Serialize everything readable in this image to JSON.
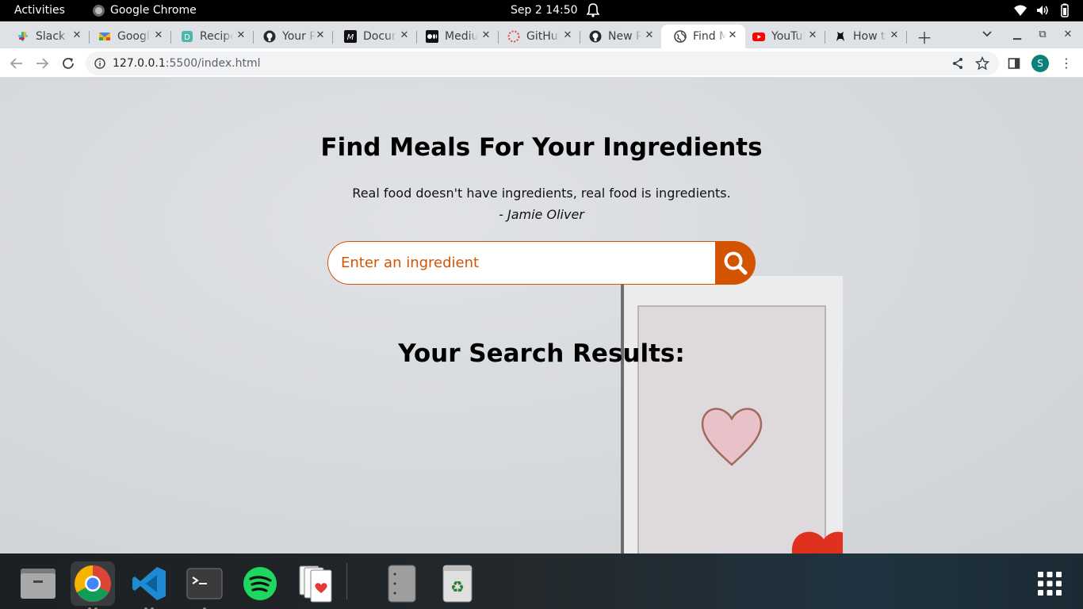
{
  "system": {
    "activities": "Activities",
    "app_name": "Google Chrome",
    "clock": "Sep 2  14:50"
  },
  "tabs": [
    {
      "title": "Slack",
      "icon": "slack-icon"
    },
    {
      "title": "Google",
      "icon": "google-workspace-icon"
    },
    {
      "title": "Recipe",
      "icon": "d-app-icon"
    },
    {
      "title": "Your Repositories",
      "icon": "github-icon"
    },
    {
      "title": "Document",
      "icon": "m-doc-icon"
    },
    {
      "title": "Medium",
      "icon": "medium-icon"
    },
    {
      "title": "GitHub",
      "icon": "loading-icon"
    },
    {
      "title": "New Repository",
      "icon": "github-icon"
    },
    {
      "title": "Find Meals",
      "icon": "globe-icon",
      "active": true
    },
    {
      "title": "YouTube",
      "icon": "youtube-icon"
    },
    {
      "title": "How to",
      "icon": "cat-icon"
    }
  ],
  "address_bar": {
    "host": "127.0.0.1",
    "rest": ":5500/index.html"
  },
  "profile_initial": "S",
  "page": {
    "title": "Find Meals For Your Ingredients",
    "quote": "Real food doesn't have ingredients, real food is ingredients.",
    "quote_author": "- Jamie Oliver",
    "search_placeholder": "Enter an ingredient",
    "results_title": "Your Search Results:",
    "accent_color": "#d35400"
  },
  "dock": [
    {
      "name": "files-icon",
      "running": false
    },
    {
      "name": "chrome-icon",
      "running": true,
      "active": true
    },
    {
      "name": "vscode-icon",
      "running": true
    },
    {
      "name": "terminal-icon",
      "running": true
    },
    {
      "name": "spotify-icon",
      "running": false
    },
    {
      "name": "solitaire-icon",
      "running": false
    },
    {
      "name": "disk-icon",
      "running": false
    },
    {
      "name": "trash-icon",
      "running": false
    },
    {
      "name": "app-grid-icon",
      "running": false
    }
  ]
}
